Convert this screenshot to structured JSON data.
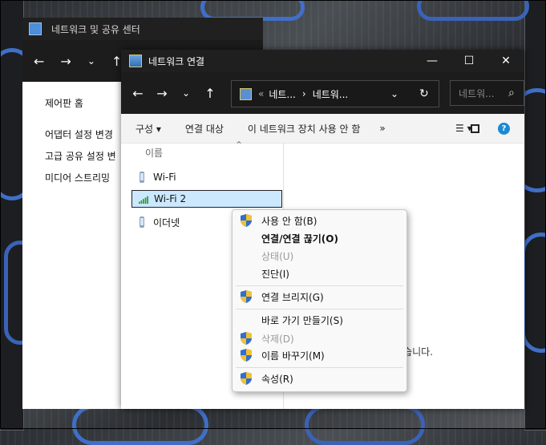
{
  "background_window": {
    "title": "네트워크 및 공유 센터",
    "nav_back": "←",
    "nav_forward": "→",
    "nav_dropdown": "⌄",
    "nav_up": "↑",
    "control_panel_home": "제어판 홈",
    "links": [
      "어댑터 설정 변경",
      "고급 공유 설정 변",
      "미디어 스트리밍"
    ]
  },
  "main_window": {
    "title": "네트워크 연결",
    "minimize": "—",
    "maximize": "☐",
    "close": "✕",
    "back": "←",
    "forward": "→",
    "dropdown": "⌄",
    "up": "↑",
    "address": {
      "chevrons": "«",
      "segment1": "네트...",
      "separator": "›",
      "segment2": "네트워...",
      "dropdown": "⌄",
      "refresh": "↻"
    },
    "search_placeholder": "네트워...",
    "search_icon": "⌕",
    "commands": {
      "organize": "구성 ▾",
      "connect_to": "연결 대상",
      "disable_device": "이 네트워크 장치 사용 안 함",
      "more": "»",
      "view": "☰ ▾",
      "help": "?"
    },
    "column_header": "이름",
    "sort_arrow": "⌃",
    "items": [
      "Wi-Fi",
      "Wi-Fi 2",
      "이더넷"
    ],
    "status_text": "없습니다."
  },
  "context_menu": {
    "items": [
      {
        "label": "사용 안 함(B)",
        "shield": true,
        "bold": false,
        "disabled": false
      },
      {
        "label": "연결/연결 끊기(O)",
        "shield": false,
        "bold": true,
        "disabled": false
      },
      {
        "label": "상태(U)",
        "shield": false,
        "bold": false,
        "disabled": true
      },
      {
        "label": "진단(I)",
        "shield": false,
        "bold": false,
        "disabled": false
      },
      {
        "label": "연결 브리지(G)",
        "shield": true,
        "bold": false,
        "disabled": false
      },
      {
        "label": "바로 가기 만들기(S)",
        "shield": false,
        "bold": false,
        "disabled": false
      },
      {
        "label": "삭제(D)",
        "shield": true,
        "bold": false,
        "disabled": true
      },
      {
        "label": "이름 바꾸기(M)",
        "shield": true,
        "bold": false,
        "disabled": false
      },
      {
        "label": "속성(R)",
        "shield": true,
        "bold": false,
        "disabled": false
      }
    ]
  },
  "colors": {
    "titlebar_dark": "#1f1f1f",
    "selection": "#cce8ff",
    "help_blue": "#1a8ad4",
    "shield_blue": "#2f6fd0",
    "shield_yellow": "#f2c12e"
  }
}
